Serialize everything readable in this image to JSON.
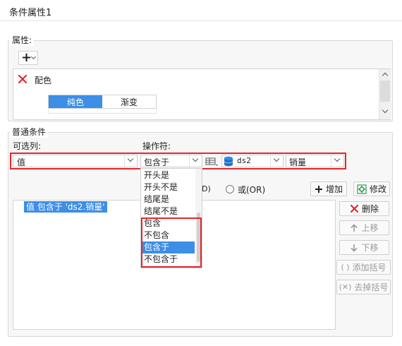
{
  "window": {
    "title": "条件属性1"
  },
  "properties": {
    "section_label": "属性:",
    "add_symbol": "+",
    "item_label": "配色",
    "tabs": [
      {
        "label": "纯色",
        "active": true
      },
      {
        "label": "渐变",
        "active": false
      }
    ]
  },
  "conditions": {
    "section_label": "普通条件",
    "column_label": "可选列:",
    "operator_label": "操作符:",
    "column_value": "值",
    "operator_value": "包含于",
    "dataset_value": "ds2",
    "field_value": "销量",
    "operator_options": [
      "开头是",
      "开头不是",
      "结尾是",
      "结尾不是",
      "包含",
      "不包含",
      "包含于",
      "不包含于"
    ],
    "selected_option": "包含于",
    "radio_and_partial": "D)",
    "radio_or": "或(OR)",
    "add_button": "增加",
    "edit_button": "修改",
    "list_items": [
      "值 包含于 'ds2.销量'"
    ],
    "delete_button": "删除",
    "up_button": "上移",
    "down_button": "下移",
    "add_bracket_button": "添加括号",
    "remove_bracket_button": "去掉括号"
  },
  "colors": {
    "accent": "#3c8ee6",
    "highlight": "#e4272d",
    "delete_red": "#e4272d",
    "add_green": "#2e9d4a"
  }
}
